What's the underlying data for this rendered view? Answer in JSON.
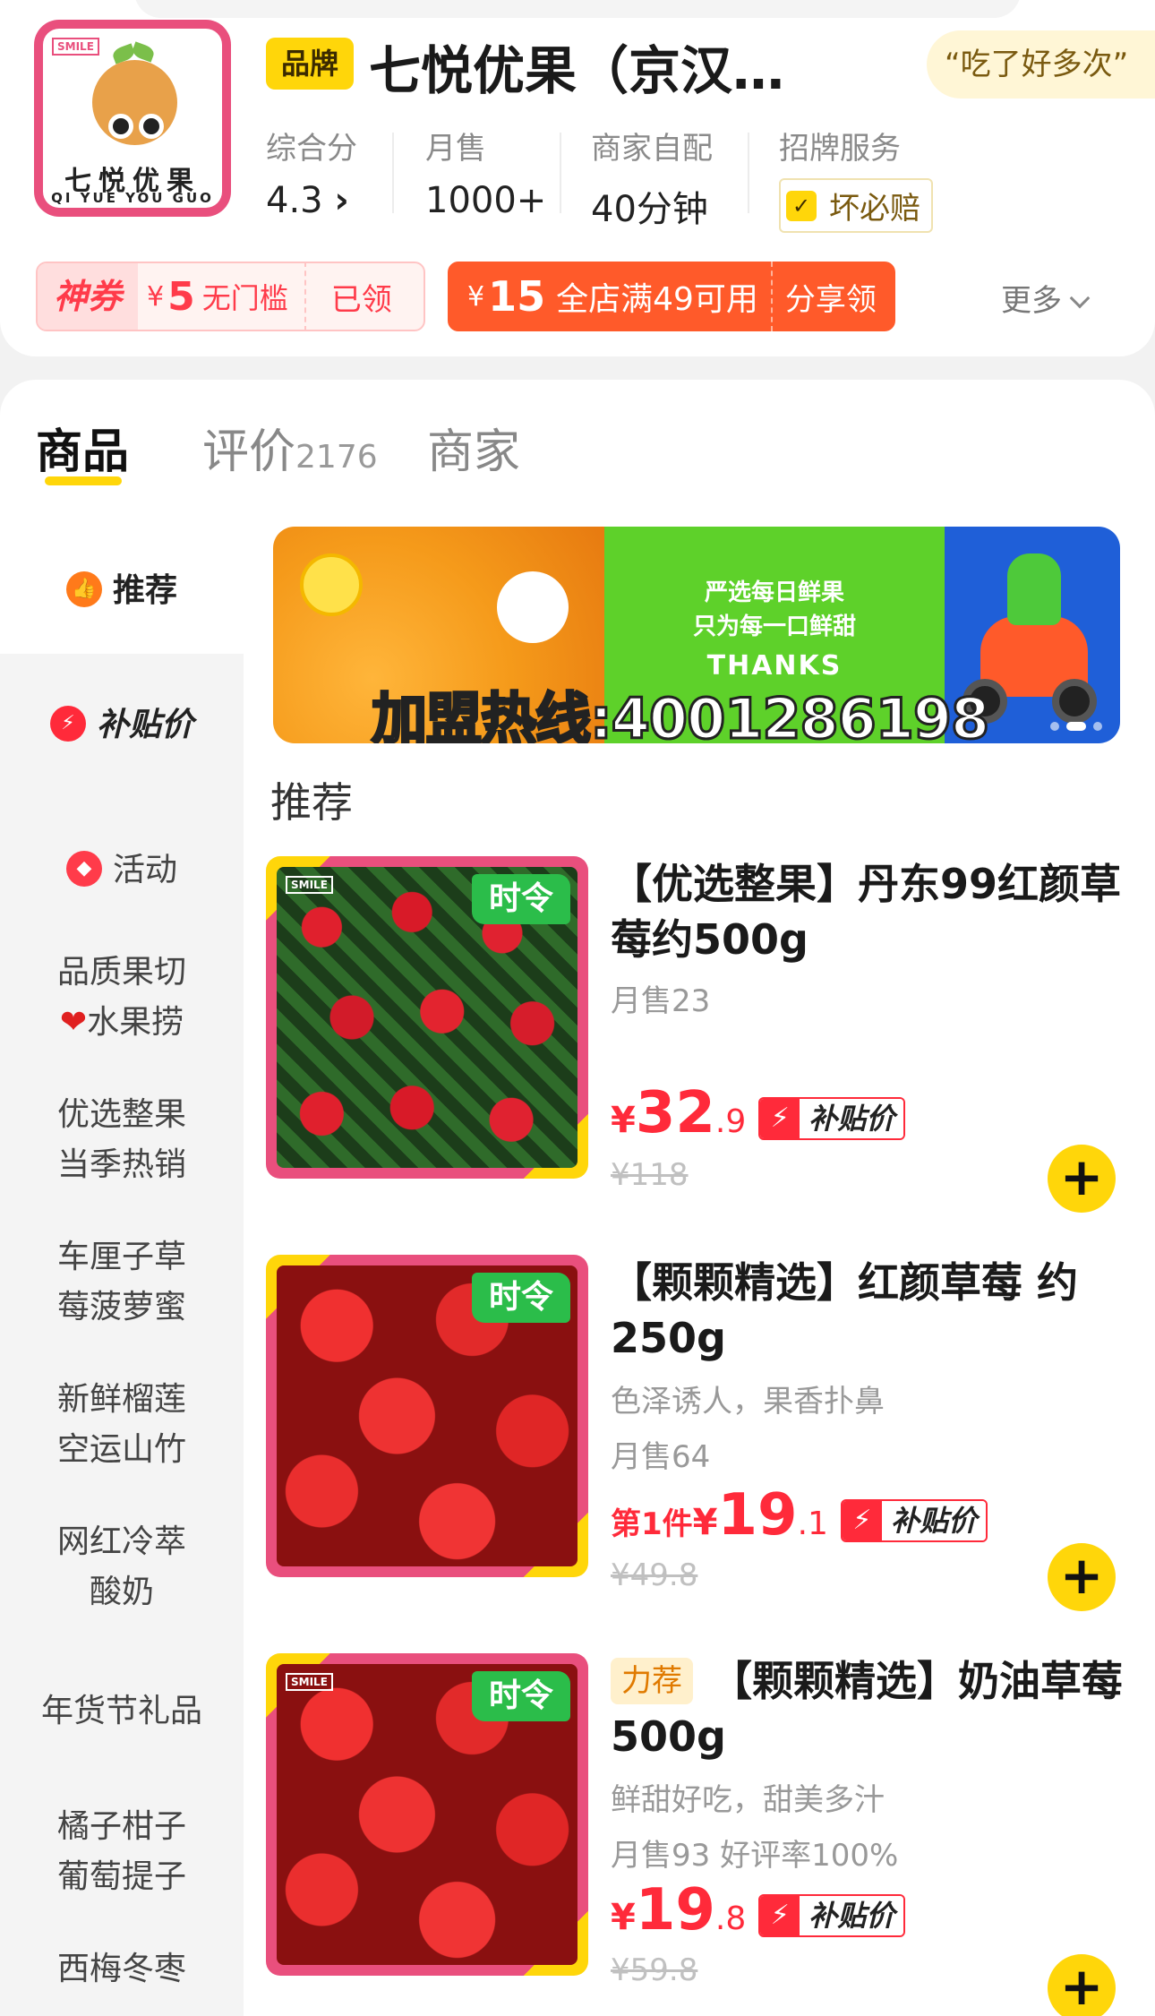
{
  "store": {
    "logo": {
      "badge": "SMILE",
      "title": "七悦优果",
      "subtitle": "QI YUE YOU GUO"
    },
    "brand_badge": "品牌",
    "name": "七悦优果（京汉…",
    "quote": "“吃了好多次”",
    "stats": [
      {
        "label": "综合分",
        "value": "4.3"
      },
      {
        "label": "月售",
        "value": "1000+"
      },
      {
        "label": "商家自配",
        "value": "40分钟"
      },
      {
        "label": "招牌服务",
        "value": "坏必赔"
      }
    ],
    "coupon1": {
      "tag": "神券",
      "yen": "¥",
      "amount": "5",
      "condition": "无门槛",
      "state": "已领"
    },
    "coupon2": {
      "yen": "¥",
      "amount": "15",
      "condition": "全店满49可用",
      "action": "分享领"
    },
    "more": "更多"
  },
  "tabs": {
    "products": "商品",
    "reviews": "评价",
    "reviews_count": "2176",
    "merchant": "商家"
  },
  "sidebar": {
    "items": [
      {
        "label": "推荐",
        "icon": "thumbs-up-icon"
      },
      {
        "label": "补贴价",
        "icon": "bolt-icon"
      },
      {
        "label": "活动",
        "icon": "tag-icon"
      },
      {
        "line1": "品质果切",
        "line2": "水果捞",
        "icon": "heart-icon"
      },
      {
        "line1": "优选整果",
        "line2": "当季热销"
      },
      {
        "line1": "车厘子草",
        "line2": "莓菠萝蜜"
      },
      {
        "line1": "新鲜榴莲",
        "line2": "空运山竹"
      },
      {
        "line1": "网红冷萃",
        "line2": "酸奶"
      },
      {
        "label": "年货节礼品"
      },
      {
        "line1": "橘子柑子",
        "line2": "葡萄提子"
      },
      {
        "line1": "西梅冬枣",
        "line2": ""
      }
    ]
  },
  "banner": {
    "slogan_line1": "严选每日鲜果",
    "slogan_line2": "只为每一口鲜甜",
    "thanks": "THANKS",
    "hotline": "加盟热线:4001286198"
  },
  "section_title": "推荐",
  "products": [
    {
      "season_tag": "时令",
      "hot_tag": "",
      "name": "【优选整果】丹东99红颜草莓约500g",
      "desc": "",
      "sales": "月售23",
      "price_prefix": "",
      "price_int": "32",
      "price_dec": ".9",
      "deal_label": "补贴价",
      "original": "¥118"
    },
    {
      "season_tag": "时令",
      "hot_tag": "",
      "name": "【颗颗精选】红颜草莓 约250g",
      "desc": "色泽诱人，果香扑鼻",
      "sales": "月售64",
      "price_prefix": "第1件",
      "price_int": "19",
      "price_dec": ".1",
      "deal_label": "补贴价",
      "original": "¥49.8"
    },
    {
      "season_tag": "时令",
      "hot_tag": "力荐",
      "name": "【颗颗精选】奶油草莓500g",
      "desc": "鲜甜好吃，甜美多汁",
      "sales": "月售93   好评率100%",
      "price_prefix": "",
      "price_int": "19",
      "price_dec": ".8",
      "deal_label": "补贴价",
      "original": "¥59.8"
    }
  ],
  "colors": {
    "brand_yellow": "#ffd60a",
    "price_red": "#ff2a3a",
    "coupon_orange": "#ff5a2a",
    "season_green": "#2bbd4a"
  }
}
